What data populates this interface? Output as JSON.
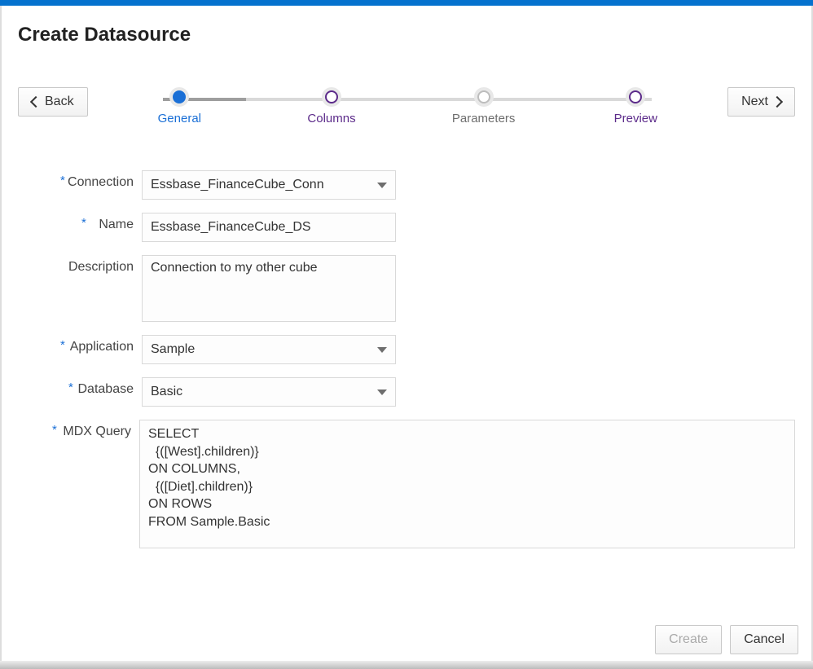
{
  "title": "Create Datasource",
  "nav": {
    "back": "Back",
    "next": "Next"
  },
  "stepper": {
    "steps": [
      {
        "label": "General",
        "state": "current"
      },
      {
        "label": "Columns",
        "state": "visited"
      },
      {
        "label": "Parameters",
        "state": "muted"
      },
      {
        "label": "Preview",
        "state": "visited"
      }
    ]
  },
  "form": {
    "connection": {
      "label": "Connection",
      "value": "Essbase_FinanceCube_Conn",
      "required": true
    },
    "name": {
      "label": "Name",
      "value": "Essbase_FinanceCube_DS",
      "required": true
    },
    "description": {
      "label": "Description",
      "value": "Connection to my other cube",
      "required": false
    },
    "application": {
      "label": "Application",
      "value": "Sample",
      "required": true
    },
    "database": {
      "label": "Database",
      "value": "Basic",
      "required": true
    },
    "mdx": {
      "label": "MDX Query",
      "value": "SELECT\n  {([West].children)}\nON COLUMNS,\n  {([Diet].children)}\nON ROWS\nFROM Sample.Basic",
      "required": true
    }
  },
  "footer": {
    "create": "Create",
    "cancel": "Cancel"
  }
}
